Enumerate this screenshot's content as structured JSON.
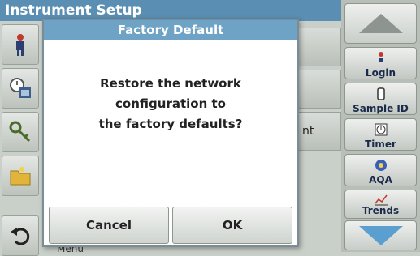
{
  "header": {
    "title": "Instrument Setup"
  },
  "background": {
    "row_text": "nt",
    "bottom_text": "Menu"
  },
  "dialog": {
    "title": "Factory Default",
    "message_lines": [
      "Restore the network",
      "configuration to",
      "the factory defaults?"
    ],
    "cancel_label": "Cancel",
    "ok_label": "OK"
  },
  "right_panel": {
    "login_label": "Login",
    "sample_id_label": "Sample ID",
    "timer_label": "Timer",
    "aqa_label": "AQA",
    "trends_label": "Trends"
  },
  "icons": {
    "left": [
      "operator-icon",
      "clock-calendar-icon",
      "key-icon",
      "folder-icon",
      "back-icon"
    ],
    "right": [
      "scroll-up-icon",
      "login-icon",
      "sample-id-icon",
      "timer-icon",
      "aqa-icon",
      "trends-icon",
      "scroll-down-icon"
    ]
  },
  "colors": {
    "header_blue": "#5a8fb3",
    "dialog_title_blue": "#6ea3c6",
    "arrow_blue": "#5b9fd0"
  }
}
